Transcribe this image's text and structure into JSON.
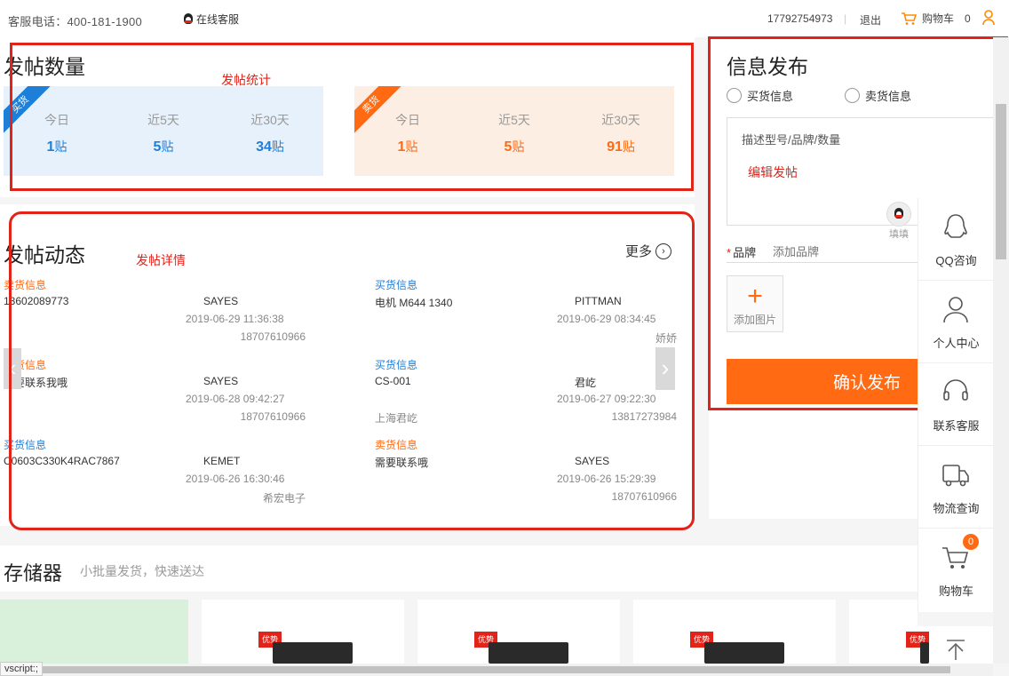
{
  "topbar": {
    "hotline": "客服电话：400-181-1900",
    "online_service": "在线客服",
    "phone": "17792754973",
    "separator": "|",
    "logout": "退出",
    "cart_label": "购物车",
    "cart_count": "0"
  },
  "stats": {
    "title": "发帖数量",
    "annotation": "发帖统计",
    "buy": {
      "ribbon": "买货",
      "columns": [
        {
          "label": "今日",
          "value": "1",
          "unit": "贴"
        },
        {
          "label": "近5天",
          "value": "5",
          "unit": "贴"
        },
        {
          "label": "近30天",
          "value": "34",
          "unit": "贴"
        }
      ]
    },
    "sell": {
      "ribbon": "卖货",
      "columns": [
        {
          "label": "今日",
          "value": "1",
          "unit": "贴"
        },
        {
          "label": "近5天",
          "value": "5",
          "unit": "贴"
        },
        {
          "label": "近30天",
          "value": "91",
          "unit": "贴"
        }
      ]
    }
  },
  "feed": {
    "title": "发帖动态",
    "annotation": "发帖详情",
    "more": "更多",
    "items": [
      {
        "kind": "卖货信息",
        "type": "sell",
        "desc": "13602089773",
        "who": "SAYES",
        "time": "2019-06-29 11:36:38",
        "contact": "18707610966",
        "loc": ""
      },
      {
        "kind": "买货信息",
        "type": "buy",
        "desc": "电机 M644 1340",
        "who": "PITTMAN",
        "time": "2019-06-29 08:34:45",
        "contact": "娇娇",
        "loc": ""
      },
      {
        "kind": "卖货信息",
        "type": "sell",
        "desc": "需要联系我哦",
        "who": "SAYES",
        "time": "2019-06-28 09:42:27",
        "contact": "18707610966",
        "loc": ""
      },
      {
        "kind": "买货信息",
        "type": "buy",
        "desc": "CS-001",
        "who": "君屹",
        "time": "2019-06-27 09:22:30",
        "contact": "13817273984",
        "loc": "上海君屹"
      },
      {
        "kind": "买货信息",
        "type": "buy",
        "desc": "C0603C330K4RAC7867",
        "who": "KEMET",
        "time": "2019-06-26 16:30:46",
        "contact": "希宏电子",
        "loc": ""
      },
      {
        "kind": "卖货信息",
        "type": "sell",
        "desc": "需要联系哦",
        "who": "SAYES",
        "time": "2019-06-26 15:29:39",
        "contact": "18707610966",
        "loc": ""
      }
    ]
  },
  "publish": {
    "title": "信息发布",
    "radio_buy": "买货信息",
    "radio_sell": "卖货信息",
    "textarea_placeholder": "描述型号/品牌/数量",
    "annotation": "编辑发帖",
    "brand_star": "*",
    "brand_label": "品牌",
    "brand_placeholder": "添加品牌",
    "add_image": "添加图片",
    "confirm": "确认发布",
    "qq_float_label": "填填"
  },
  "sidebar": {
    "items": [
      {
        "label": "QQ咨询",
        "icon": "qq-penguin-icon"
      },
      {
        "label": "个人中心",
        "icon": "user-icon"
      },
      {
        "label": "联系客服",
        "icon": "headset-icon"
      },
      {
        "label": "物流查询",
        "icon": "truck-icon"
      },
      {
        "label": "购物车",
        "icon": "cart-icon",
        "badge": "0"
      }
    ]
  },
  "storage": {
    "title": "存储器",
    "subtitle": "小批量发货，快速送达",
    "product_tag": "优势"
  },
  "statusbar": {
    "text": "vscript:;"
  },
  "colors": {
    "accent_orange": "#ff6a13",
    "accent_blue": "#1e7fd8",
    "annotation_red": "#e2231a"
  }
}
